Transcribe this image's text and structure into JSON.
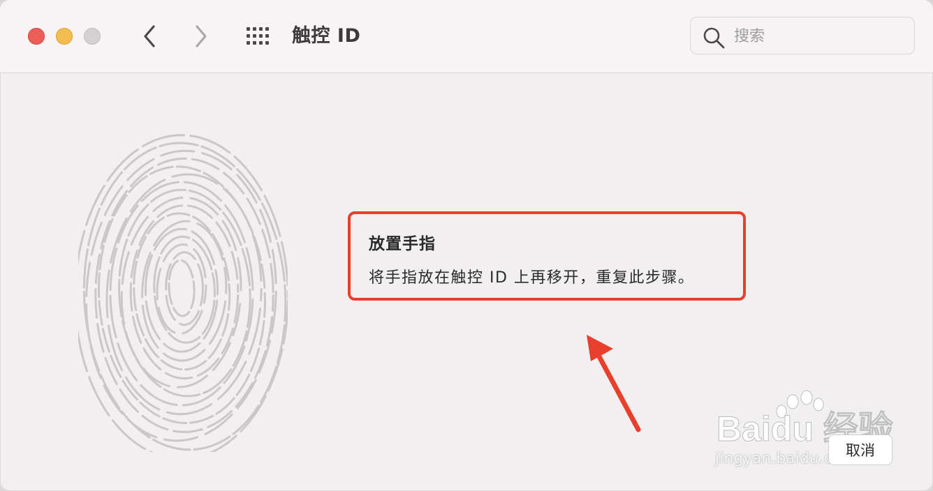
{
  "window": {
    "title": "触控 ID",
    "traffic_lights": [
      "close",
      "minimize",
      "zoom"
    ],
    "colors": {
      "close": "#ec5f59",
      "minimize": "#f4bd4f",
      "zoom": "#d3d1d1"
    }
  },
  "toolbar": {
    "back_icon": "chevron-left-icon",
    "forward_icon": "chevron-right-icon",
    "grid_icon": "show-all-grid-icon"
  },
  "search": {
    "placeholder": "搜索",
    "value": "",
    "icon": "search-icon"
  },
  "enroll": {
    "heading": "放置手指",
    "instruction": "将手指放在触控 ID 上再移开，重复此步骤。",
    "fingerprint_icon": "fingerprint-icon"
  },
  "annotation": {
    "highlight_color": "#e8402d",
    "arrow_icon": "red-arrow-icon"
  },
  "buttons": {
    "cancel_label": "取消"
  },
  "watermark": {
    "logo_text": "Baidu 经验",
    "url_text": "jingyan.baidu.com"
  }
}
